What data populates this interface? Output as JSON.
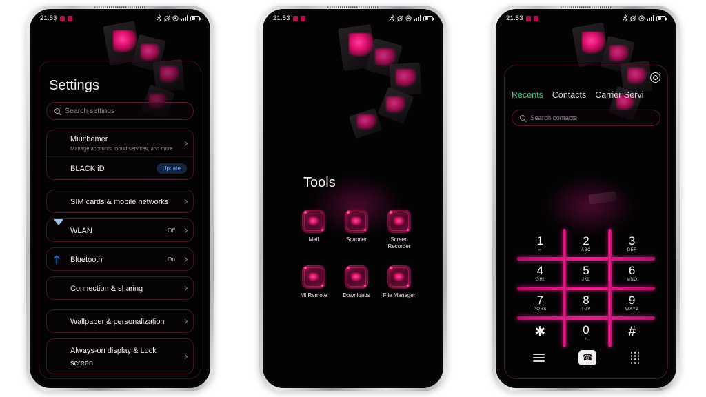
{
  "page": {
    "background": "#ffffff",
    "accent": "#e81e8e",
    "device_count": 3
  },
  "status_bar": {
    "time": "21:53",
    "icons": [
      "bluetooth-icon",
      "vibrate-icon",
      "alarm-icon",
      "signal-bars-icon",
      "battery-icon"
    ]
  },
  "phone1": {
    "screen": "settings",
    "title": "Settings",
    "search": {
      "placeholder": "Search settings"
    },
    "groups": [
      {
        "items": [
          {
            "label": "Miuithemer",
            "sublabel": "Manage accounts, cloud services, and more",
            "icon": "brush-icon",
            "value": "",
            "chevron": true
          },
          {
            "label": "BLACK iD",
            "sublabel": "",
            "icon": "account-card-icon",
            "badge": "Update",
            "chevron": false
          }
        ]
      },
      {
        "items": [
          {
            "label": "SIM cards & mobile networks",
            "sublabel": "",
            "icon": "sim-card-icon",
            "value": "",
            "chevron": true
          },
          {
            "label": "WLAN",
            "sublabel": "",
            "icon": "wifi-icon",
            "value": "Off",
            "chevron": true
          },
          {
            "label": "Bluetooth",
            "sublabel": "",
            "icon": "bluetooth-icon",
            "value": "On",
            "chevron": true
          },
          {
            "label": "Connection & sharing",
            "sublabel": "",
            "icon": "connection-sharing-icon",
            "value": "",
            "chevron": true
          }
        ]
      },
      {
        "items": [
          {
            "label": "Wallpaper & personalization",
            "sublabel": "",
            "icon": "wallpaper-icon",
            "value": "",
            "chevron": true
          },
          {
            "label": "Always-on display & Lock screen",
            "sublabel": "",
            "icon": "lock-screen-icon",
            "value": "",
            "chevron": true
          }
        ]
      }
    ]
  },
  "phone2": {
    "screen": "app-folder",
    "folder_title": "Tools",
    "apps": [
      {
        "label": "Mail",
        "icon": "mail-app-icon"
      },
      {
        "label": "Scanner",
        "icon": "scanner-app-icon"
      },
      {
        "label": "Screen Recorder",
        "icon": "screen-recorder-app-icon"
      },
      {
        "label": "Mi Remote",
        "icon": "mi-remote-app-icon"
      },
      {
        "label": "Downloads",
        "icon": "downloads-app-icon"
      },
      {
        "label": "File Manager",
        "icon": "file-manager-app-icon"
      }
    ]
  },
  "phone3": {
    "screen": "dialer",
    "settings_icon": "gear-icon",
    "tabs": [
      {
        "label": "Recents",
        "active": true
      },
      {
        "label": "Contacts",
        "active": false
      },
      {
        "label": "Carrier Servi",
        "active": false
      }
    ],
    "active_tab_color": "#2ecb7f",
    "search": {
      "placeholder": "Search contacts"
    },
    "keypad": [
      {
        "num": "1",
        "sub": "∞"
      },
      {
        "num": "2",
        "sub": "ABC"
      },
      {
        "num": "3",
        "sub": "DEF"
      },
      {
        "num": "4",
        "sub": "GHI"
      },
      {
        "num": "5",
        "sub": "JKL"
      },
      {
        "num": "6",
        "sub": "MNO"
      },
      {
        "num": "7",
        "sub": "PQRS"
      },
      {
        "num": "8",
        "sub": "TUV"
      },
      {
        "num": "9",
        "sub": "WXYZ"
      },
      {
        "num": "✱",
        "sub": ""
      },
      {
        "num": "0",
        "sub": "+"
      },
      {
        "num": "#",
        "sub": ""
      }
    ],
    "navbar": [
      {
        "icon": "menu-icon",
        "label": ""
      },
      {
        "icon": "call-icon",
        "label": "☎"
      },
      {
        "icon": "dialpad-icon",
        "label": ""
      }
    ]
  }
}
